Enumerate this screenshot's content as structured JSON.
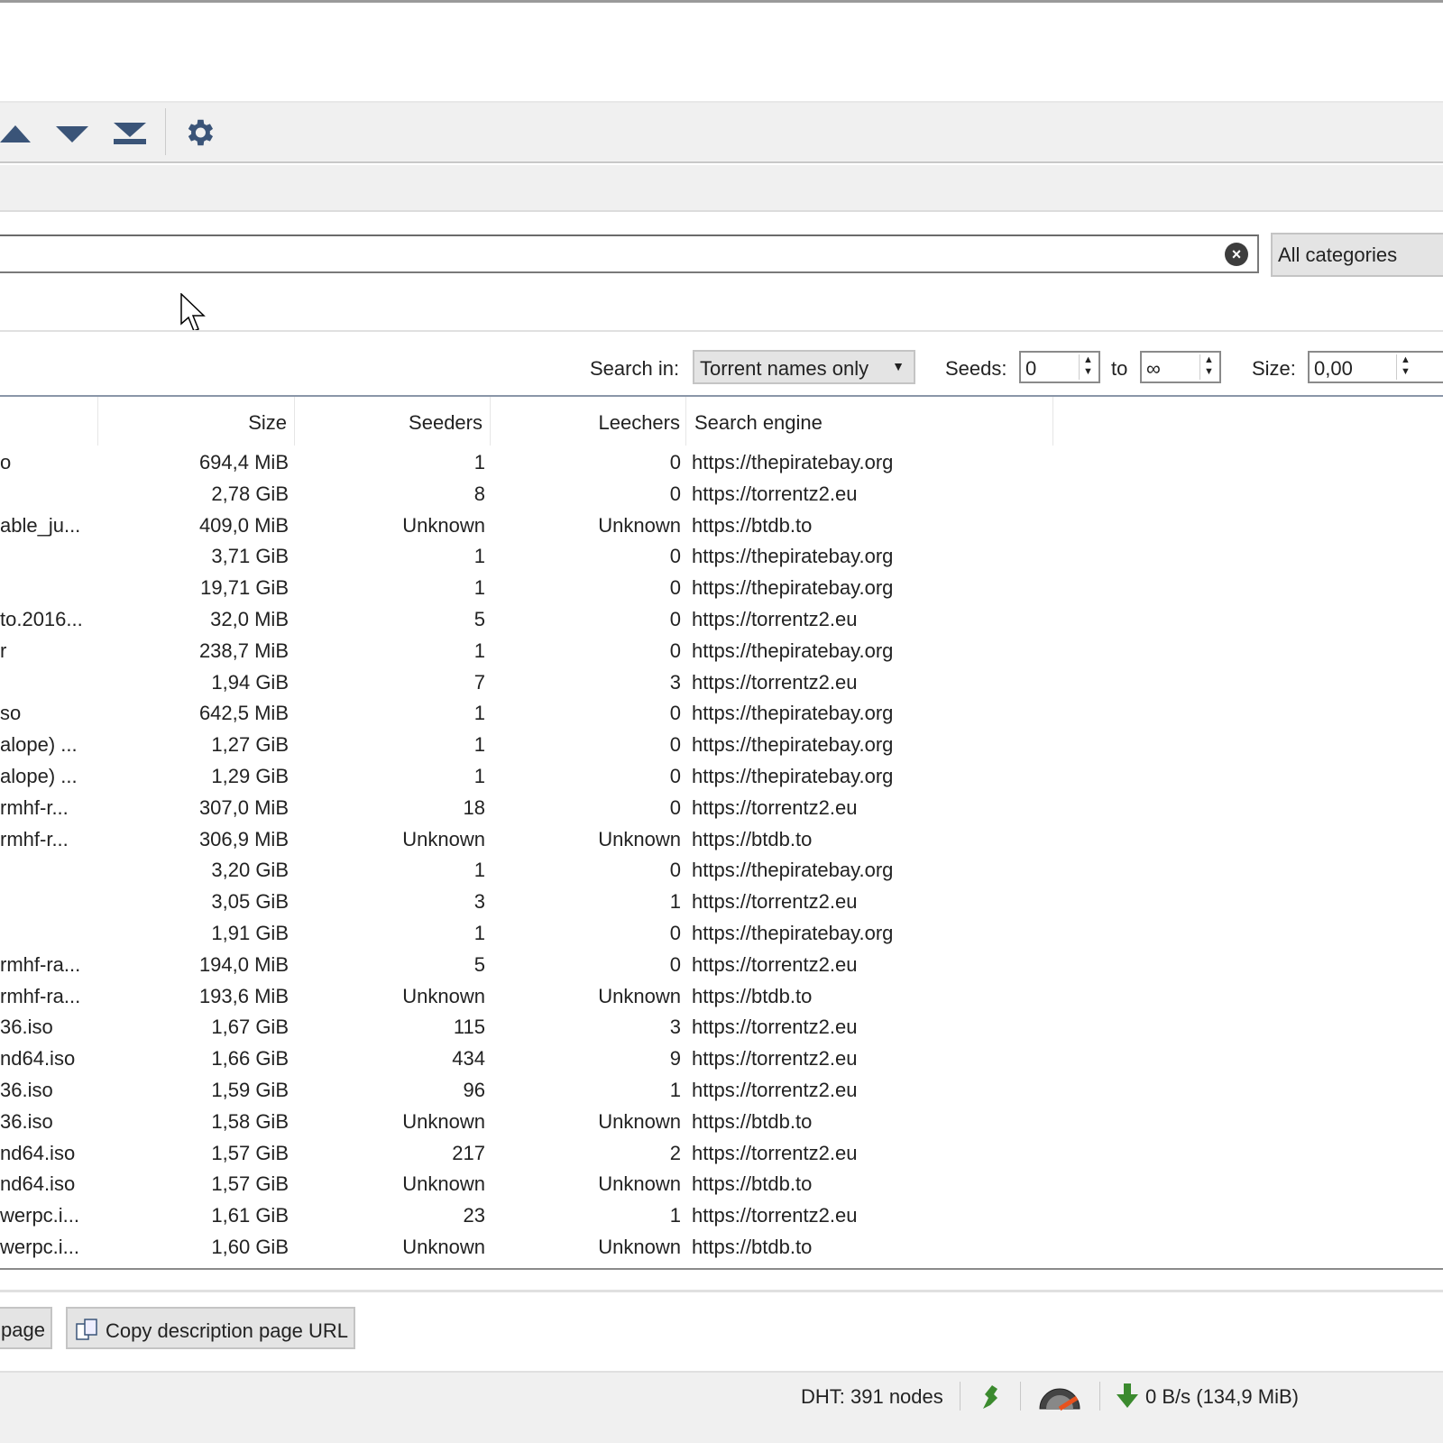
{
  "search": {
    "value": "",
    "clear_icon": "clear-icon",
    "category": "All categories"
  },
  "filters": {
    "search_in_label": "Search in:",
    "search_in_value": "Torrent names only",
    "seeds_label": "Seeds:",
    "seeds_min": "0",
    "to_label": "to",
    "seeds_max": "∞",
    "size_label": "Size:",
    "size_min": "0,00"
  },
  "table": {
    "columns": [
      "Size",
      "Seeders",
      "Leechers",
      "Search engine"
    ],
    "rows": [
      [
        "o",
        "694,4 MiB",
        "1",
        "0",
        "https://thepiratebay.org"
      ],
      [
        "",
        "2,78 GiB",
        "8",
        "0",
        "https://torrentz2.eu"
      ],
      [
        "able_ju...",
        "409,0 MiB",
        "Unknown",
        "Unknown",
        "https://btdb.to"
      ],
      [
        "",
        "3,71 GiB",
        "1",
        "0",
        "https://thepiratebay.org"
      ],
      [
        "",
        "19,71 GiB",
        "1",
        "0",
        "https://thepiratebay.org"
      ],
      [
        "to.2016...",
        "32,0 MiB",
        "5",
        "0",
        "https://torrentz2.eu"
      ],
      [
        "r",
        "238,7 MiB",
        "1",
        "0",
        "https://thepiratebay.org"
      ],
      [
        "",
        "1,94 GiB",
        "7",
        "3",
        "https://torrentz2.eu"
      ],
      [
        "so",
        "642,5 MiB",
        "1",
        "0",
        "https://thepiratebay.org"
      ],
      [
        "alope) ...",
        "1,27 GiB",
        "1",
        "0",
        "https://thepiratebay.org"
      ],
      [
        "alope) ...",
        "1,29 GiB",
        "1",
        "0",
        "https://thepiratebay.org"
      ],
      [
        "rmhf-r...",
        "307,0 MiB",
        "18",
        "0",
        "https://torrentz2.eu"
      ],
      [
        "rmhf-r...",
        "306,9 MiB",
        "Unknown",
        "Unknown",
        "https://btdb.to"
      ],
      [
        "",
        "3,20 GiB",
        "1",
        "0",
        "https://thepiratebay.org"
      ],
      [
        "",
        "3,05 GiB",
        "3",
        "1",
        "https://torrentz2.eu"
      ],
      [
        "",
        "1,91 GiB",
        "1",
        "0",
        "https://thepiratebay.org"
      ],
      [
        "rmhf-ra...",
        "194,0 MiB",
        "5",
        "0",
        "https://torrentz2.eu"
      ],
      [
        "rmhf-ra...",
        "193,6 MiB",
        "Unknown",
        "Unknown",
        "https://btdb.to"
      ],
      [
        "36.iso",
        "1,67 GiB",
        "115",
        "3",
        "https://torrentz2.eu"
      ],
      [
        "nd64.iso",
        "1,66 GiB",
        "434",
        "9",
        "https://torrentz2.eu"
      ],
      [
        "36.iso",
        "1,59 GiB",
        "96",
        "1",
        "https://torrentz2.eu"
      ],
      [
        "36.iso",
        "1,58 GiB",
        "Unknown",
        "Unknown",
        "https://btdb.to"
      ],
      [
        "nd64.iso",
        "1,57 GiB",
        "217",
        "2",
        "https://torrentz2.eu"
      ],
      [
        "nd64.iso",
        "1,57 GiB",
        "Unknown",
        "Unknown",
        "https://btdb.to"
      ],
      [
        "werpc.i...",
        "1,61 GiB",
        "23",
        "1",
        "https://torrentz2.eu"
      ],
      [
        "werpc.i...",
        "1,60 GiB",
        "Unknown",
        "Unknown",
        "https://btdb.to"
      ]
    ]
  },
  "buttons": {
    "open_page": "page",
    "copy_url": "Copy description page URL"
  },
  "status": {
    "dht": "DHT: 391 nodes",
    "speed": "0 B/s (134,9 MiB)"
  },
  "colors": {
    "icon_blue": "#3a5478",
    "green": "#3b8a2e",
    "orange": "#e8521e"
  }
}
